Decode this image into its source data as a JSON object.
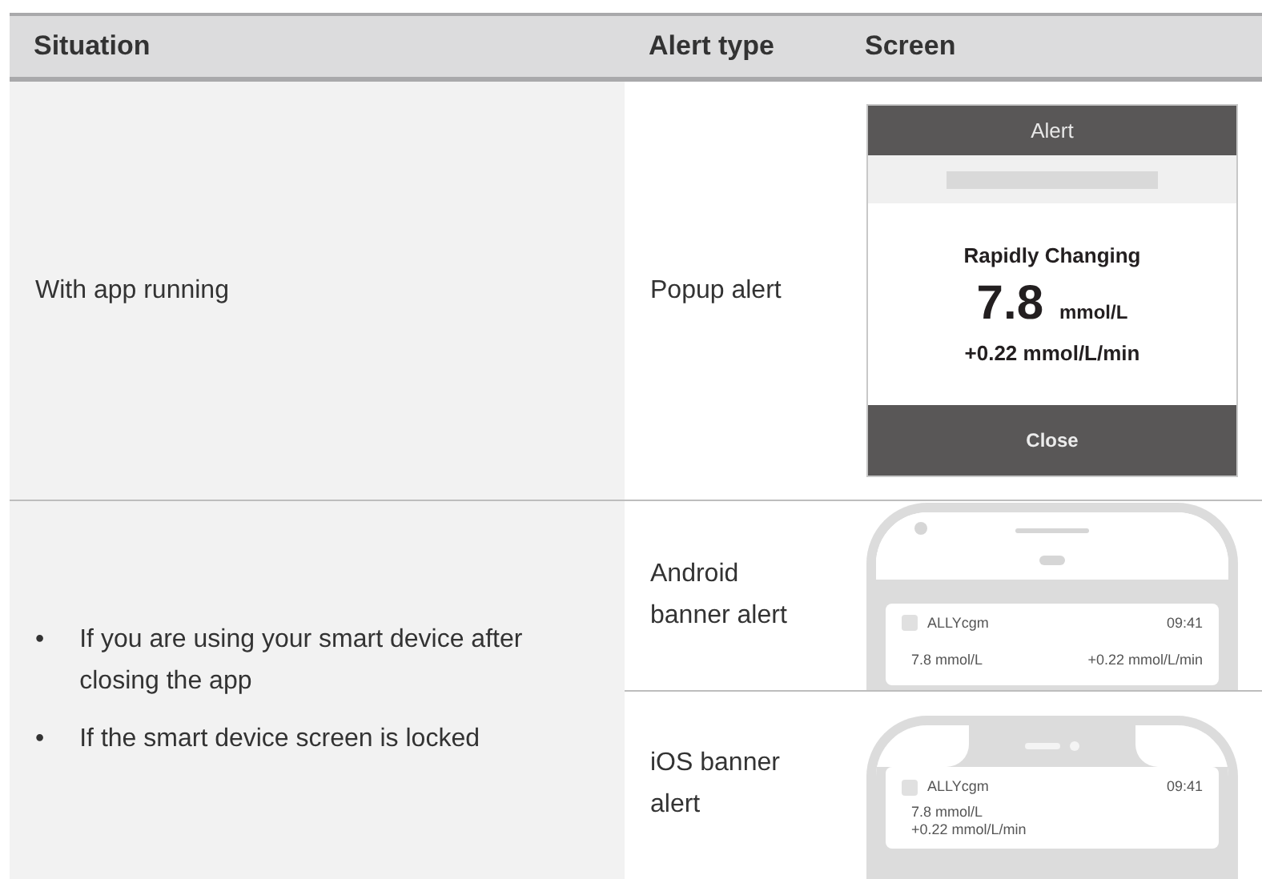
{
  "table": {
    "columns": [
      "Situation",
      "Alert type",
      "Screen"
    ],
    "rows": [
      {
        "situation": [
          {
            "text": "With app running"
          }
        ],
        "alerts": [
          {
            "alert_type": "Popup alert",
            "screen": {
              "kind": "popup",
              "title": "Alert",
              "heading": "Rapidly Changing",
              "value": "7.8",
              "unit": "mmol/L",
              "rate": "+0.22 mmol/L/min",
              "button": "Close"
            }
          }
        ]
      },
      {
        "situation": [
          {
            "bullet": "•",
            "text": "If you are using your smart device after closing the app"
          },
          {
            "bullet": "•",
            "text": "If the smart device screen is locked"
          }
        ],
        "alerts": [
          {
            "alert_type": "Android banner alert",
            "screen": {
              "kind": "android",
              "app": "ALLYcgm",
              "time": "09:41",
              "value": "7.8 mmol/L",
              "rate": "+0.22 mmol/L/min"
            }
          },
          {
            "alert_type": "iOS banner alert",
            "screen": {
              "kind": "ios",
              "app": "ALLYcgm",
              "time": "09:41",
              "value": "7.8 mmol/L",
              "rate": "+0.22 mmol/L/min"
            }
          }
        ]
      }
    ]
  }
}
